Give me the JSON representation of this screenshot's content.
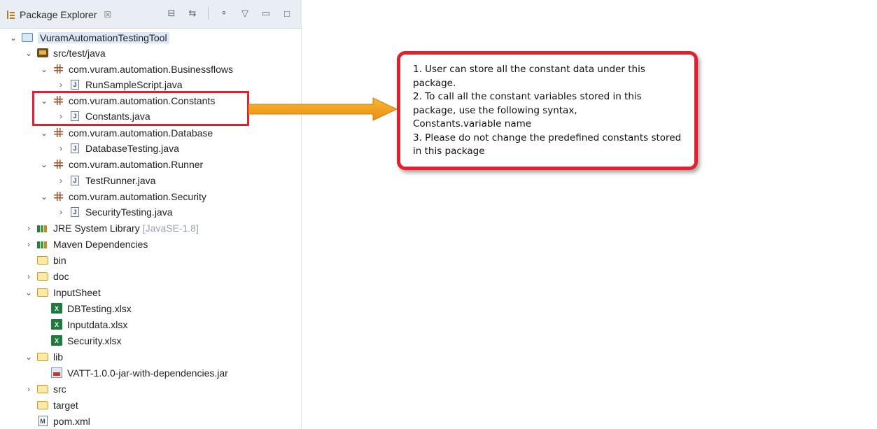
{
  "view": {
    "tab_title": "Package Explorer",
    "tab_close": "☒"
  },
  "tree": {
    "project": "VuramAutomationTestingTool",
    "source_folder": "src/test/java",
    "packages": [
      {
        "name": "com.vuram.automation.Businessflows",
        "file": "RunSampleScript.java"
      },
      {
        "name": "com.vuram.automation.Constants",
        "file": "Constants.java"
      },
      {
        "name": "com.vuram.automation.Database",
        "file": "DatabaseTesting.java"
      },
      {
        "name": "com.vuram.automation.Runner",
        "file": "TestRunner.java"
      },
      {
        "name": "com.vuram.automation.Security",
        "file": "SecurityTesting.java"
      }
    ],
    "jre_library": "JRE System Library",
    "jre_version": "[JavaSE-1.8]",
    "maven": "Maven Dependencies",
    "bin": "bin",
    "doc": "doc",
    "input_sheet": "InputSheet",
    "input_files": [
      "DBTesting.xlsx",
      "Inputdata.xlsx",
      "Security.xlsx"
    ],
    "lib": "lib",
    "lib_jar": "VATT-1.0.0-jar-with-dependencies.jar",
    "src": "src",
    "target": "target",
    "pom": "pom.xml"
  },
  "callout": {
    "line1": "1. User can store all the constant data under this package.",
    "line2": "2. To call all the constant variables stored in this package, use the following syntax,",
    "line3": "Constants.variable name",
    "line4": "3. Please do not change the predefined constants stored in this package"
  },
  "colors": {
    "annotation_red": "#e4202e",
    "arrow_orange": "#f2a21b"
  }
}
